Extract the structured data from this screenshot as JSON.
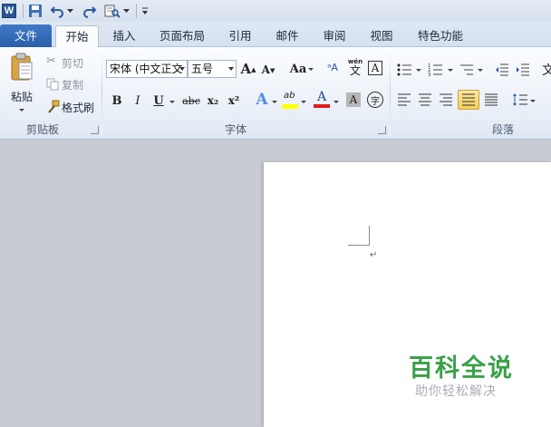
{
  "quick_access": {
    "logo_letter": "W",
    "items": [
      "save-icon",
      "undo-icon",
      "redo-icon",
      "print-preview-icon",
      "customize-icon"
    ]
  },
  "tabs": [
    {
      "label": "文件"
    },
    {
      "label": "开始"
    },
    {
      "label": "插入"
    },
    {
      "label": "页面布局"
    },
    {
      "label": "引用"
    },
    {
      "label": "邮件"
    },
    {
      "label": "审阅"
    },
    {
      "label": "视图"
    },
    {
      "label": "特色功能"
    }
  ],
  "clipboard": {
    "paste_label": "粘贴",
    "cut_label": "剪切",
    "copy_label": "复制",
    "format_painter_label": "格式刷",
    "group_label": "剪贴板"
  },
  "font": {
    "font_name": "宋体 (中文正文",
    "font_size": "五号",
    "grow_glyph": "A",
    "shrink_glyph": "A",
    "case_glyph": "Aa",
    "pinyin_top": "wén",
    "pinyin_bottom": "文",
    "border_glyph": "A",
    "bold": "B",
    "italic": "I",
    "underline": "U",
    "strike": "abc",
    "subscript": "x₂",
    "superscript": "x²",
    "effects_glyph": "A",
    "highlight_glyph": "ab",
    "color_glyph": "A",
    "shade_glyph": "A",
    "encircle_glyph": "字",
    "group_label": "字体",
    "colors": {
      "highlight": "#ffff00",
      "font_color": "#e01b1b",
      "effects": "#4a90e2"
    }
  },
  "paragraph": {
    "group_label": "段落"
  },
  "document": {
    "paragraph_mark": "↵"
  },
  "watermark": {
    "title": "百科全说",
    "subtitle": "助你轻松解决"
  },
  "colors": {
    "file_tab": "#2f66b3",
    "watermark_green": "#3aa04a"
  }
}
